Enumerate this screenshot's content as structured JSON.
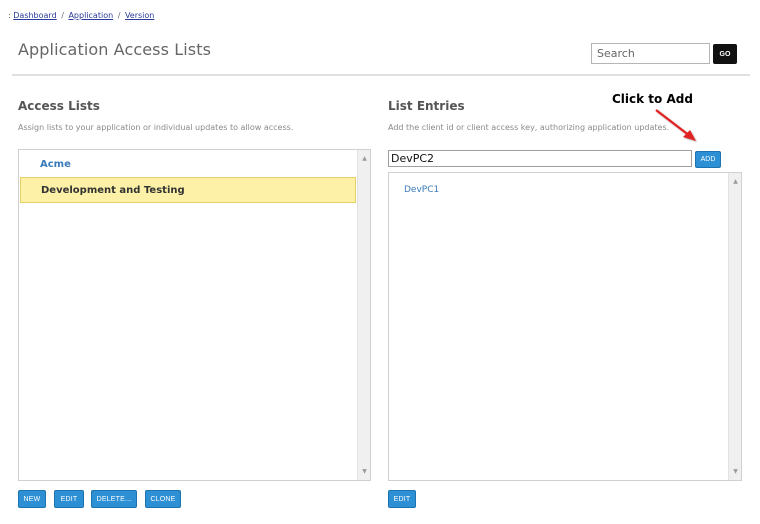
{
  "breadcrumb": {
    "prefix": ":",
    "items": [
      "Dashboard",
      "Application",
      "Version"
    ],
    "separator": "/"
  },
  "page_title": "Application Access Lists",
  "search": {
    "placeholder": "Search",
    "value": "",
    "go_label": "GO"
  },
  "access_lists": {
    "title": "Access Lists",
    "description": "Assign lists to your application or individual updates to allow access.",
    "items": [
      {
        "label": "Acme",
        "selected": false
      },
      {
        "label": "Development and Testing",
        "selected": true
      }
    ],
    "buttons": {
      "new": "NEW",
      "edit": "EDIT",
      "delete": "DELETE...",
      "clone": "CLONE"
    }
  },
  "list_entries": {
    "title": "List Entries",
    "description": "Add the client id or client access key, authorizing application updates.",
    "input_value": "DevPC2",
    "add_label": "ADD",
    "items": [
      "DevPC1"
    ],
    "edit_label": "EDIT"
  },
  "annotation": {
    "text": "Click to Add",
    "color": "#e02020"
  },
  "colors": {
    "accent_button": "#2d8fd4",
    "selected_row": "#fcf1a6",
    "link": "#3a7ab8"
  },
  "icons": {
    "scroll_up": "scroll-up-arrow-icon",
    "scroll_down": "scroll-down-arrow-icon",
    "callout_arrow": "red-arrow-icon"
  }
}
